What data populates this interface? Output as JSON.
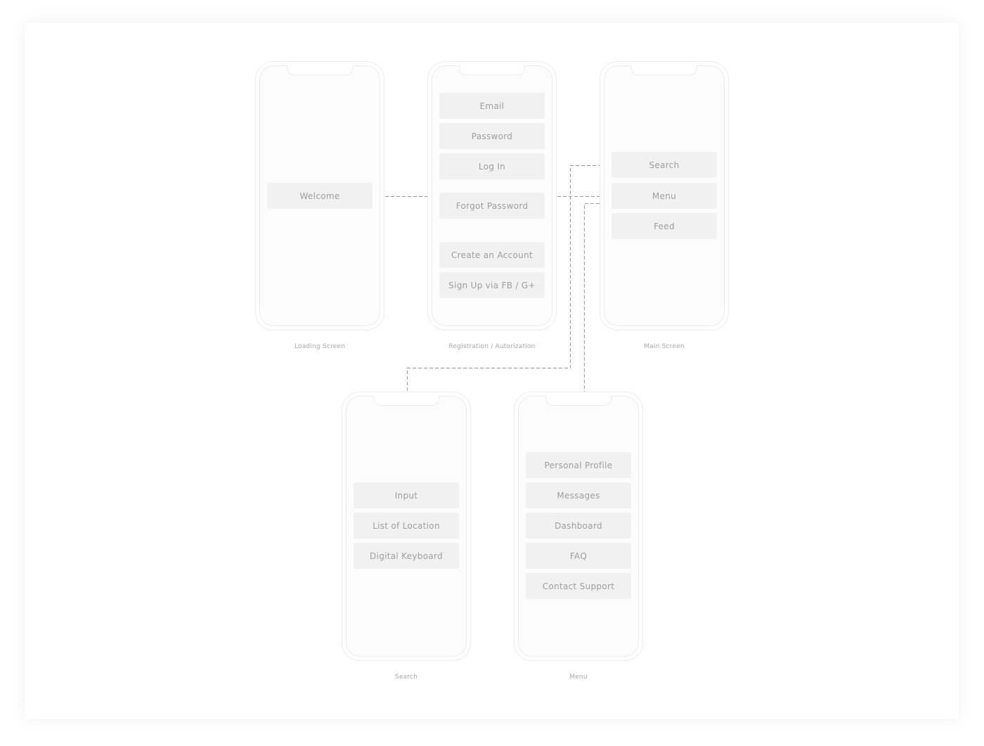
{
  "screens": {
    "loading": {
      "caption": "Loading Screen",
      "buttons": [
        "Welcome"
      ]
    },
    "registration": {
      "caption": "Registration / Autorization",
      "buttons": [
        "Email",
        "Password",
        "Log In",
        "Forgot Password",
        "Create an Account",
        "Sign Up via FB / G+"
      ]
    },
    "main": {
      "caption": "Main Screen",
      "buttons": [
        "Search",
        "Menu",
        "Feed"
      ]
    },
    "search": {
      "caption": "Search",
      "buttons": [
        "Input",
        "List of Location",
        "Digital Keyboard"
      ]
    },
    "menu": {
      "caption": "Menu",
      "buttons": [
        "Personal Profile",
        "Messages",
        "Dashboard",
        "FAQ",
        "Contact Support"
      ]
    }
  },
  "connections": [
    {
      "from": "loading",
      "to": "registration"
    },
    {
      "from": "registration",
      "to": "main"
    },
    {
      "from": "main.Search",
      "to": "search"
    },
    {
      "from": "main.Menu",
      "to": "menu"
    }
  ]
}
